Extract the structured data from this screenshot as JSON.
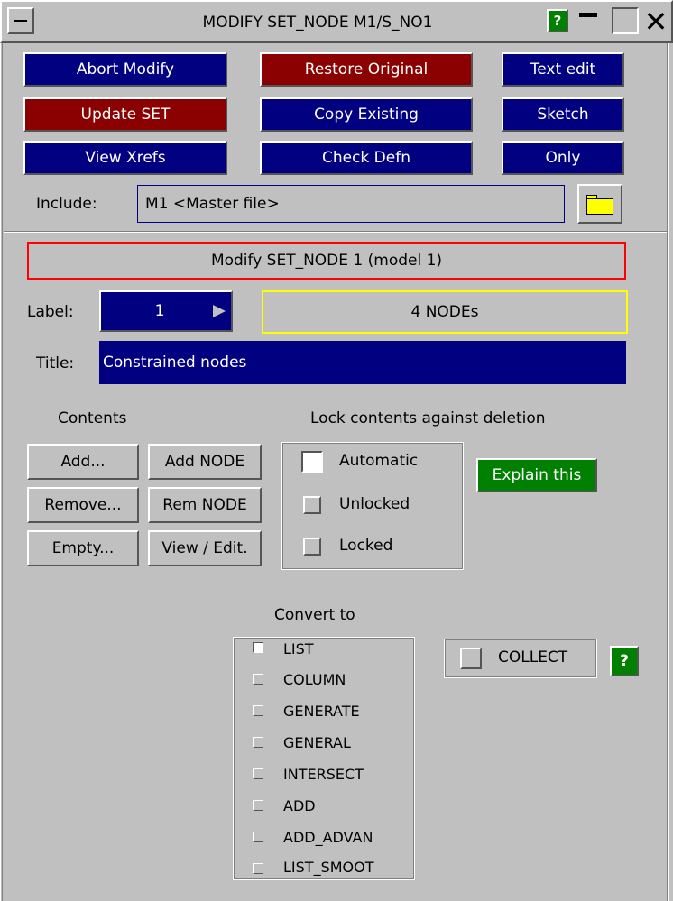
{
  "window": {
    "title": "MODIFY SET_NODE M1/S_NO1",
    "help_label": "?"
  },
  "toolbar": {
    "abort_modify": "Abort Modify",
    "restore_original": "Restore Original",
    "text_edit": "Text edit",
    "update_set": "Update SET",
    "copy_existing": "Copy Existing",
    "sketch": "Sketch",
    "view_xrefs": "View Xrefs",
    "check_defn": "Check Defn",
    "only": "Only"
  },
  "include": {
    "label": "Include:",
    "value": "M1  <Master file>"
  },
  "modify_header": "Modify SET_NODE 1 (model 1)",
  "label_row": {
    "label": "Label:",
    "value": "1",
    "count": "4 NODEs"
  },
  "title_row": {
    "label": "Title:",
    "value": "Constrained nodes"
  },
  "contents": {
    "heading": "Contents",
    "add": "Add...",
    "add_node": "Add NODE",
    "remove": "Remove...",
    "rem_node": "Rem NODE",
    "empty": "Empty...",
    "view_edit": "View / Edit."
  },
  "lock": {
    "heading": "Lock contents against deletion",
    "options": [
      "Automatic",
      "Unlocked",
      "Locked"
    ],
    "selected": "Automatic",
    "explain": "Explain this"
  },
  "convert": {
    "heading": "Convert to",
    "options": [
      "LIST",
      "COLUMN",
      "GENERATE",
      "GENERAL",
      "INTERSECT",
      "ADD",
      "ADD_ADVAN",
      "LIST_SMOOT"
    ],
    "selected": "LIST",
    "collect_label": "COLLECT",
    "help_label": "?"
  },
  "colors": {
    "panel": "#c0c0c0",
    "blue_button": "#000080",
    "red_button": "#8b0000",
    "green_button": "#008000",
    "folder": "#ffff00"
  }
}
